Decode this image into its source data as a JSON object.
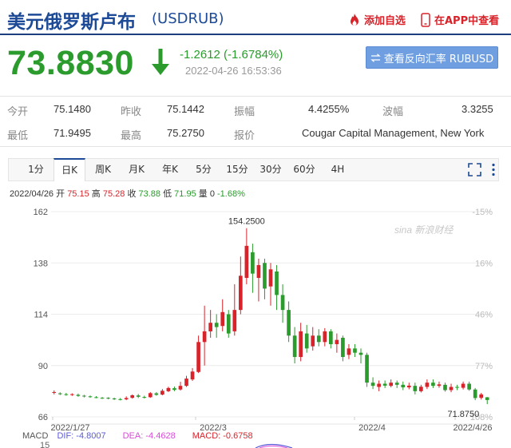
{
  "header": {
    "title_cn": "美元俄罗斯卢布",
    "title_code": "(USDRUB)",
    "add_favorite": "添加自选",
    "view_in_app": "在APP中查看"
  },
  "quote": {
    "price": "73.8830",
    "change": "-1.2612 (-1.6784%)",
    "timestamp": "2022-04-26 16:53:36",
    "reverse_button": "查看反向汇率 RUBUSD"
  },
  "stats": {
    "open_label": "今开",
    "open": "75.1480",
    "prev_close_label": "昨收",
    "prev_close": "75.1442",
    "amplitude_label": "振幅",
    "amplitude": "4.4255%",
    "wave_label": "波幅",
    "wave": "3.3255",
    "low_label": "最低",
    "low": "71.9495",
    "high_label": "最高",
    "high": "75.2750",
    "quote_label": "报价",
    "quote_src": "Cougar Capital Management, New York"
  },
  "tabs": [
    "1分",
    "日K",
    "周K",
    "月K",
    "年K",
    "5分",
    "15分",
    "30分",
    "60分",
    "4H"
  ],
  "active_tab": "日K",
  "ohlc": {
    "date": "2022/04/26",
    "open_label": "开",
    "open": "75.15",
    "high_label": "高",
    "high": "75.28",
    "close_label": "收",
    "close": "73.88",
    "low_label": "低",
    "low": "71.95",
    "volume_label": "量",
    "volume": "0",
    "change_pct": "-1.68%"
  },
  "macd": {
    "label": "MACD",
    "dif": "DIF: -4.8007",
    "dea": "DEA: -4.4628",
    "macd": "MACD: -0.6758",
    "axis_top": "15"
  },
  "watermark": "sina 新浪财经",
  "colors": {
    "up": "#d8232a",
    "down": "#2a9b2c",
    "brand": "#1d4a97",
    "button": "#6f9fe0"
  },
  "chart_data": {
    "type": "candlestick",
    "y_ticks": [
      66,
      90,
      114,
      138,
      162
    ],
    "y_right_ticks": [
      "108%",
      "77%",
      "46%",
      "16%",
      "-15%"
    ],
    "x_labels": [
      "2022/1/27",
      "2022/3",
      "2022/4",
      "2022/4/26"
    ],
    "ylim": [
      66,
      162
    ],
    "high_annotation": "154.2500",
    "low_annotation": "71.8750",
    "candles": [
      {
        "o": 77.2,
        "c": 77.6,
        "h": 78.4,
        "l": 76.5
      },
      {
        "o": 77.0,
        "c": 76.6,
        "h": 77.5,
        "l": 76.2
      },
      {
        "o": 76.6,
        "c": 76.3,
        "h": 77.2,
        "l": 75.9
      },
      {
        "o": 76.4,
        "c": 76.6,
        "h": 77.0,
        "l": 75.8
      },
      {
        "o": 76.3,
        "c": 75.8,
        "h": 76.9,
        "l": 75.4
      },
      {
        "o": 75.9,
        "c": 75.6,
        "h": 76.3,
        "l": 75.1
      },
      {
        "o": 75.6,
        "c": 75.3,
        "h": 76.0,
        "l": 74.9
      },
      {
        "o": 75.2,
        "c": 75.0,
        "h": 75.7,
        "l": 74.7
      },
      {
        "o": 74.9,
        "c": 74.8,
        "h": 75.3,
        "l": 74.4
      },
      {
        "o": 74.9,
        "c": 74.6,
        "h": 75.2,
        "l": 74.2
      },
      {
        "o": 74.6,
        "c": 74.3,
        "h": 75.0,
        "l": 73.9
      },
      {
        "o": 74.3,
        "c": 74.1,
        "h": 74.8,
        "l": 73.7
      },
      {
        "o": 74.2,
        "c": 74.8,
        "h": 75.6,
        "l": 73.8
      },
      {
        "o": 74.9,
        "c": 76.1,
        "h": 76.5,
        "l": 74.5
      },
      {
        "o": 76.0,
        "c": 75.4,
        "h": 76.7,
        "l": 74.8
      },
      {
        "o": 75.3,
        "c": 75.0,
        "h": 75.9,
        "l": 74.6
      },
      {
        "o": 75.2,
        "c": 77.1,
        "h": 77.6,
        "l": 74.9
      },
      {
        "o": 77.0,
        "c": 76.3,
        "h": 77.6,
        "l": 75.9
      },
      {
        "o": 76.4,
        "c": 78.2,
        "h": 79.0,
        "l": 76.1
      },
      {
        "o": 78.0,
        "c": 79.5,
        "h": 80.1,
        "l": 77.6
      },
      {
        "o": 79.4,
        "c": 78.6,
        "h": 80.2,
        "l": 78.0
      },
      {
        "o": 78.8,
        "c": 80.5,
        "h": 82.4,
        "l": 78.3
      },
      {
        "o": 80.5,
        "c": 83.9,
        "h": 85.2,
        "l": 80.0
      },
      {
        "o": 83.5,
        "c": 87.2,
        "h": 88.8,
        "l": 82.8
      },
      {
        "o": 87.0,
        "c": 101.0,
        "h": 104.0,
        "l": 86.5
      },
      {
        "o": 101.0,
        "c": 106.0,
        "h": 118.0,
        "l": 90.0
      },
      {
        "o": 106.0,
        "c": 110.0,
        "h": 116.0,
        "l": 103.0
      },
      {
        "o": 110.0,
        "c": 108.0,
        "h": 114.0,
        "l": 103.0
      },
      {
        "o": 108.5,
        "c": 115.0,
        "h": 121.0,
        "l": 106.0
      },
      {
        "o": 114.0,
        "c": 105.0,
        "h": 116.0,
        "l": 103.0
      },
      {
        "o": 106.0,
        "c": 116.0,
        "h": 128.0,
        "l": 104.0
      },
      {
        "o": 116.0,
        "c": 132.0,
        "h": 141.0,
        "l": 114.0
      },
      {
        "o": 131.0,
        "c": 146.0,
        "h": 154.25,
        "l": 128.0
      },
      {
        "o": 143.0,
        "c": 133.0,
        "h": 147.0,
        "l": 124.0
      },
      {
        "o": 131.0,
        "c": 137.0,
        "h": 140.0,
        "l": 120.0
      },
      {
        "o": 138.0,
        "c": 126.0,
        "h": 140.0,
        "l": 121.0
      },
      {
        "o": 127.0,
        "c": 135.0,
        "h": 138.0,
        "l": 118.0
      },
      {
        "o": 134.0,
        "c": 123.0,
        "h": 137.0,
        "l": 116.0
      },
      {
        "o": 123.0,
        "c": 116.0,
        "h": 128.0,
        "l": 110.0
      },
      {
        "o": 116.0,
        "c": 104.0,
        "h": 120.0,
        "l": 101.0
      },
      {
        "o": 104.0,
        "c": 94.0,
        "h": 108.0,
        "l": 91.0
      },
      {
        "o": 94.0,
        "c": 106.0,
        "h": 110.0,
        "l": 92.0
      },
      {
        "o": 105.0,
        "c": 98.0,
        "h": 109.0,
        "l": 96.0
      },
      {
        "o": 99.0,
        "c": 104.0,
        "h": 108.0,
        "l": 97.0
      },
      {
        "o": 104.0,
        "c": 101.0,
        "h": 107.0,
        "l": 99.0
      },
      {
        "o": 101.0,
        "c": 106.0,
        "h": 107.5,
        "l": 99.0
      },
      {
        "o": 106.0,
        "c": 100.0,
        "h": 107.0,
        "l": 98.0
      },
      {
        "o": 100.0,
        "c": 102.0,
        "h": 105.0,
        "l": 96.0
      },
      {
        "o": 103.0,
        "c": 94.0,
        "h": 104.0,
        "l": 92.0
      },
      {
        "o": 95.0,
        "c": 98.0,
        "h": 100.0,
        "l": 93.0
      },
      {
        "o": 98.0,
        "c": 96.0,
        "h": 100.0,
        "l": 94.0
      },
      {
        "o": 96.0,
        "c": 95.0,
        "h": 98.0,
        "l": 91.0
      },
      {
        "o": 95.0,
        "c": 82.0,
        "h": 96.0,
        "l": 80.0
      },
      {
        "o": 82.0,
        "c": 80.5,
        "h": 84.5,
        "l": 79.0
      },
      {
        "o": 80.0,
        "c": 81.5,
        "h": 83.0,
        "l": 78.0
      },
      {
        "o": 81.5,
        "c": 80.6,
        "h": 83.0,
        "l": 79.5
      },
      {
        "o": 80.5,
        "c": 82.0,
        "h": 83.5,
        "l": 79.8
      },
      {
        "o": 82.0,
        "c": 81.0,
        "h": 83.0,
        "l": 79.5
      },
      {
        "o": 81.0,
        "c": 79.8,
        "h": 82.5,
        "l": 78.5
      },
      {
        "o": 79.8,
        "c": 80.6,
        "h": 82.0,
        "l": 78.9
      },
      {
        "o": 80.5,
        "c": 78.0,
        "h": 82.0,
        "l": 76.5
      },
      {
        "o": 78.0,
        "c": 80.1,
        "h": 81.0,
        "l": 77.4
      },
      {
        "o": 80.0,
        "c": 82.0,
        "h": 83.5,
        "l": 79.0
      },
      {
        "o": 82.0,
        "c": 80.5,
        "h": 83.5,
        "l": 79.5
      },
      {
        "o": 80.5,
        "c": 81.2,
        "h": 82.5,
        "l": 79.6
      },
      {
        "o": 81.0,
        "c": 78.5,
        "h": 82.0,
        "l": 77.8
      },
      {
        "o": 78.5,
        "c": 80.0,
        "h": 81.5,
        "l": 77.5
      },
      {
        "o": 80.0,
        "c": 79.6,
        "h": 81.0,
        "l": 78.5
      },
      {
        "o": 79.6,
        "c": 81.5,
        "h": 82.5,
        "l": 78.8
      },
      {
        "o": 81.5,
        "c": 78.8,
        "h": 82.5,
        "l": 78.2
      },
      {
        "o": 78.8,
        "c": 74.8,
        "h": 79.5,
        "l": 73.8
      },
      {
        "o": 74.9,
        "c": 76.5,
        "h": 77.2,
        "l": 74.1
      },
      {
        "o": 75.15,
        "c": 73.88,
        "h": 75.28,
        "l": 71.95
      }
    ]
  }
}
